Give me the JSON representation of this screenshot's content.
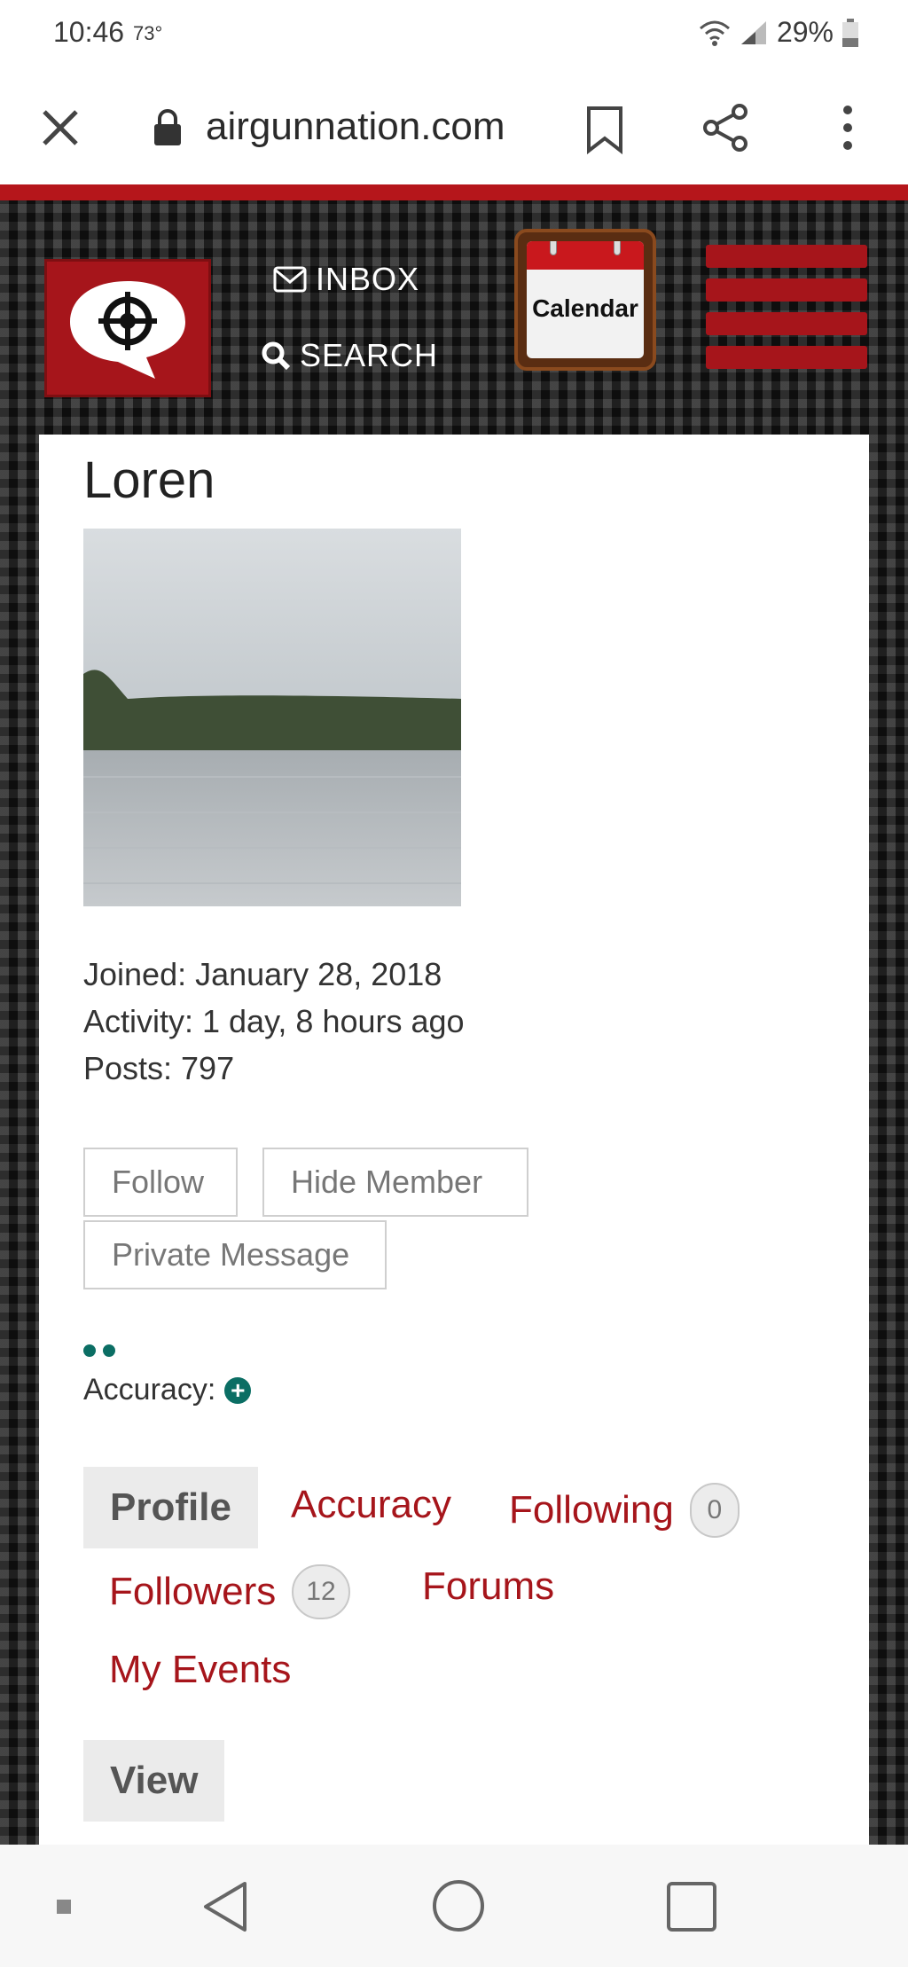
{
  "status_bar": {
    "time": "10:46",
    "temperature": "73°",
    "battery": "29%"
  },
  "browser": {
    "url": "airgunnation.com"
  },
  "site_header": {
    "inbox_label": "INBOX",
    "search_label": "SEARCH",
    "calendar_label": "Calendar",
    "accent_color": "#a6151b"
  },
  "profile": {
    "username": "Loren",
    "joined": "Joined: January 28, 2018",
    "activity": "Activity: 1 day, 8 hours ago",
    "posts": "Posts: 797",
    "buttons": {
      "follow": "Follow",
      "hide_member": "Hide Member",
      "private_message": "Private Message"
    },
    "accuracy_label": "Accuracy:"
  },
  "tabs": {
    "profile": "Profile",
    "accuracy": "Accuracy",
    "following": "Following",
    "following_count": "0",
    "followers": "Followers",
    "followers_count": "12",
    "forums": "Forums",
    "my_events": "My Events",
    "view": "View"
  }
}
